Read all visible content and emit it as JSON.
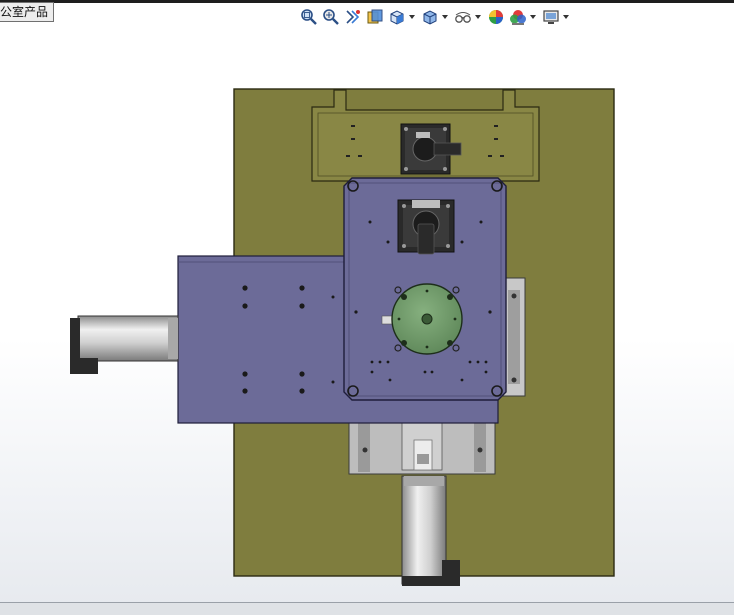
{
  "document_tab": {
    "title": "公室产品"
  },
  "toolbar": {
    "items": [
      {
        "icon": "zoom-to-fit-icon",
        "has_menu": false
      },
      {
        "icon": "zoom-to-area-icon",
        "has_menu": false
      },
      {
        "icon": "previous-view-icon",
        "has_menu": false
      },
      {
        "icon": "section-view-icon",
        "has_menu": false
      },
      {
        "icon": "view-orientation-icon",
        "has_menu": true
      },
      {
        "icon": "display-style-icon",
        "has_menu": true
      },
      {
        "icon": "hide-show-items-icon",
        "has_menu": true
      },
      {
        "icon": "edit-appearance-icon",
        "has_menu": false
      },
      {
        "icon": "apply-scene-icon",
        "has_menu": true
      },
      {
        "icon": "view-settings-icon",
        "has_menu": true
      }
    ]
  },
  "model": {
    "colors": {
      "base_plate": "#7f7d3e",
      "purple_plate": "#6c6b98",
      "rotary_disc": "#6f9a6a",
      "motor_black": "#2a2a2a",
      "rail_grey": "#b9b9b9",
      "cylinder_silver": "#d9d9d9"
    }
  }
}
